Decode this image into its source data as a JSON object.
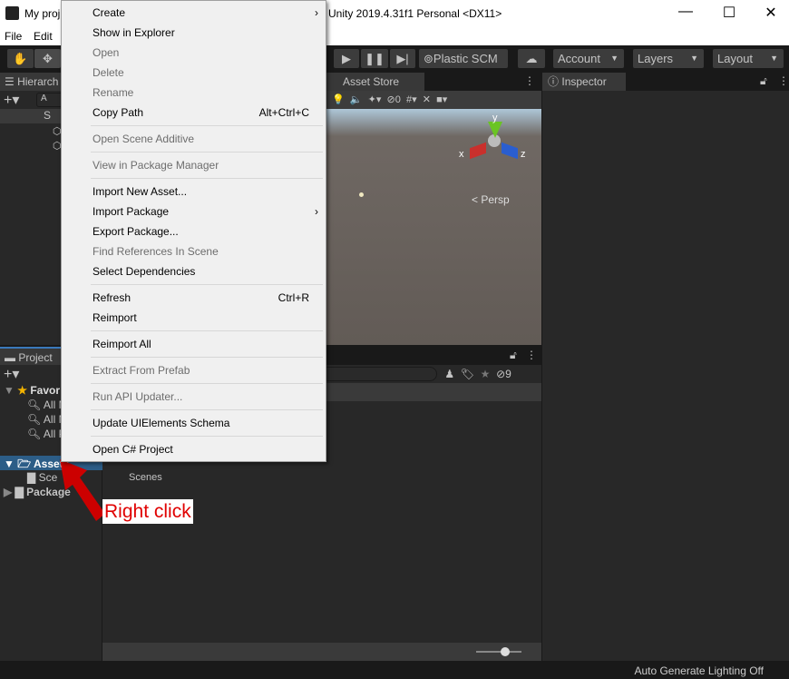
{
  "window": {
    "title_left": "My proj",
    "title_right": "Unity 2019.4.31f1 Personal <DX11>",
    "minimize": "—",
    "maximize": "☐",
    "close": "✕"
  },
  "menubar": {
    "items": [
      "File",
      "Edit"
    ]
  },
  "toolbar": {
    "plastic": "Plastic SCM",
    "account": "Account",
    "layers": "Layers",
    "layout": "Layout"
  },
  "hierarchy": {
    "tab": "Hierarch",
    "search_placeholder": "A",
    "scene_label": "S"
  },
  "scene": {
    "tab": "Asset Store",
    "hidden_count": "0",
    "persp": "Persp",
    "axes": {
      "x": "x",
      "y": "y",
      "z": "z"
    }
  },
  "inspector": {
    "tab": "Inspector"
  },
  "project": {
    "tab": "Project",
    "hidden_count": "9",
    "tree": [
      {
        "label": "Favor"
      },
      {
        "label": "All M"
      },
      {
        "label": "All M"
      },
      {
        "label": "All P"
      },
      {
        "label": "Assets"
      },
      {
        "label": "Sce"
      },
      {
        "label": "Package"
      }
    ],
    "content_item": "Scenes"
  },
  "annotation": {
    "label": "Right click",
    "color": "#e00000"
  },
  "status": {
    "text": "Auto Generate Lighting Off"
  },
  "context_menu": {
    "items": [
      {
        "label": "Create",
        "submenu": true,
        "enabled": true
      },
      {
        "label": "Show in Explorer",
        "enabled": true
      },
      {
        "label": "Open",
        "enabled": false
      },
      {
        "label": "Delete",
        "enabled": false
      },
      {
        "label": "Rename",
        "enabled": false
      },
      {
        "label": "Copy Path",
        "shortcut": "Alt+Ctrl+C",
        "enabled": true
      },
      {
        "label": "Open Scene Additive",
        "enabled": false
      },
      {
        "label": "View in Package Manager",
        "enabled": false
      },
      {
        "label": "Import New Asset...",
        "enabled": true
      },
      {
        "label": "Import Package",
        "submenu": true,
        "enabled": true
      },
      {
        "label": "Export Package...",
        "enabled": true
      },
      {
        "label": "Find References In Scene",
        "enabled": false
      },
      {
        "label": "Select Dependencies",
        "enabled": true
      },
      {
        "label": "Refresh",
        "shortcut": "Ctrl+R",
        "enabled": true
      },
      {
        "label": "Reimport",
        "enabled": true
      },
      {
        "label": "Reimport All",
        "enabled": true
      },
      {
        "label": "Extract From Prefab",
        "enabled": false
      },
      {
        "label": "Run API Updater...",
        "enabled": false
      },
      {
        "label": "Update UIElements Schema",
        "enabled": true
      },
      {
        "label": "Open C# Project",
        "enabled": true
      }
    ]
  }
}
